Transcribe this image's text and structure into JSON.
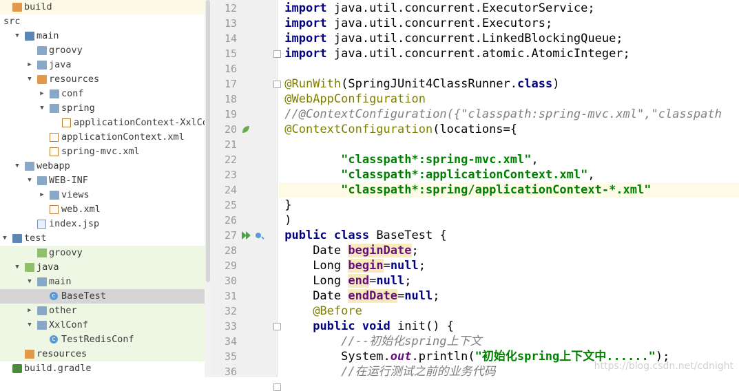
{
  "tree": {
    "items": [
      {
        "label": "build",
        "depth": 0,
        "arrow": "",
        "icon": "folder-orange",
        "bg": "#fdfbe7"
      },
      {
        "label": "src",
        "depth": 0,
        "arrow": "",
        "icon": "none",
        "bg": ""
      },
      {
        "label": "main",
        "depth": 1,
        "arrow": "down",
        "icon": "folder-src",
        "bg": ""
      },
      {
        "label": "groovy",
        "depth": 2,
        "arrow": "",
        "icon": "folder",
        "bg": ""
      },
      {
        "label": "java",
        "depth": 2,
        "arrow": "right",
        "icon": "folder",
        "bg": ""
      },
      {
        "label": "resources",
        "depth": 2,
        "arrow": "down",
        "icon": "folder-orange",
        "bg": ""
      },
      {
        "label": "conf",
        "depth": 3,
        "arrow": "right",
        "icon": "folder",
        "bg": ""
      },
      {
        "label": "spring",
        "depth": 3,
        "arrow": "down",
        "icon": "folder",
        "bg": ""
      },
      {
        "label": "applicationContext-XxlConf.xml",
        "depth": 4,
        "arrow": "",
        "icon": "xml",
        "bg": ""
      },
      {
        "label": "applicationContext.xml",
        "depth": 3,
        "arrow": "",
        "icon": "xml",
        "bg": ""
      },
      {
        "label": "spring-mvc.xml",
        "depth": 3,
        "arrow": "",
        "icon": "xml",
        "bg": ""
      },
      {
        "label": "webapp",
        "depth": 1,
        "arrow": "down",
        "icon": "folder",
        "bg": ""
      },
      {
        "label": "WEB-INF",
        "depth": 2,
        "arrow": "down",
        "icon": "folder",
        "bg": ""
      },
      {
        "label": "views",
        "depth": 3,
        "arrow": "right",
        "icon": "folder",
        "bg": ""
      },
      {
        "label": "web.xml",
        "depth": 3,
        "arrow": "",
        "icon": "xml",
        "bg": ""
      },
      {
        "label": "index.jsp",
        "depth": 2,
        "arrow": "",
        "icon": "jsp",
        "bg": ""
      },
      {
        "label": "test",
        "depth": 0,
        "arrow": "down",
        "icon": "folder-src",
        "bg": ""
      },
      {
        "label": "groovy",
        "depth": 2,
        "arrow": "",
        "icon": "folder-green",
        "bg": "#eef6e4"
      },
      {
        "label": "java",
        "depth": 1,
        "arrow": "down",
        "icon": "folder-green",
        "bg": "#eef6e4"
      },
      {
        "label": "main",
        "depth": 2,
        "arrow": "down",
        "icon": "folder",
        "bg": "#eef6e4"
      },
      {
        "label": "BaseTest",
        "depth": 3,
        "arrow": "",
        "icon": "class",
        "bg": "#d5d5d5"
      },
      {
        "label": "other",
        "depth": 2,
        "arrow": "right",
        "icon": "folder",
        "bg": "#eef6e4"
      },
      {
        "label": "XxlConf",
        "depth": 2,
        "arrow": "down",
        "icon": "folder",
        "bg": "#eef6e4"
      },
      {
        "label": "TestRedisConf",
        "depth": 3,
        "arrow": "",
        "icon": "class",
        "bg": "#eef6e4"
      },
      {
        "label": "resources",
        "depth": 1,
        "arrow": "",
        "icon": "folder-orange",
        "bg": "#eef6e4"
      },
      {
        "label": "build.gradle",
        "depth": 0,
        "arrow": "",
        "icon": "gradle",
        "bg": ""
      }
    ]
  },
  "editor": {
    "lines": [
      {
        "n": "12",
        "hl": false,
        "spans": [
          [
            "kw",
            "import"
          ],
          [
            "plain",
            " java.util.concurrent.ExecutorService;"
          ]
        ]
      },
      {
        "n": "13",
        "hl": false,
        "spans": [
          [
            "kw",
            "import"
          ],
          [
            "plain",
            " java.util.concurrent.Executors;"
          ]
        ]
      },
      {
        "n": "14",
        "hl": false,
        "spans": [
          [
            "kw",
            "import"
          ],
          [
            "plain",
            " java.util.concurrent.LinkedBlockingQueue;"
          ]
        ]
      },
      {
        "n": "15",
        "hl": false,
        "spans": [
          [
            "kw",
            "import"
          ],
          [
            "plain",
            " java.util.concurrent.atomic.AtomicInteger;"
          ]
        ]
      },
      {
        "n": "16",
        "hl": false,
        "spans": []
      },
      {
        "n": "17",
        "hl": false,
        "spans": [
          [
            "ann",
            "@RunWith"
          ],
          [
            "plain",
            "(SpringJUnit4ClassRunner."
          ],
          [
            "kw",
            "class"
          ],
          [
            "plain",
            ")"
          ]
        ]
      },
      {
        "n": "18",
        "hl": false,
        "spans": [
          [
            "ann",
            "@WebAppConfiguration"
          ]
        ]
      },
      {
        "n": "19",
        "hl": false,
        "spans": [
          [
            "cmt",
            "//@ContextConfiguration({\"classpath:spring-mvc.xml\",\"classpath"
          ]
        ]
      },
      {
        "n": "20",
        "hl": false,
        "spans": [
          [
            "ann",
            "@ContextConfiguration"
          ],
          [
            "plain",
            "(locations={"
          ]
        ]
      },
      {
        "n": "21",
        "hl": false,
        "spans": []
      },
      {
        "n": "22",
        "hl": false,
        "spans": [
          [
            "plain",
            "        "
          ],
          [
            "str",
            "\"classpath*:spring-mvc.xml\""
          ],
          [
            "plain",
            ","
          ]
        ]
      },
      {
        "n": "23",
        "hl": false,
        "spans": [
          [
            "plain",
            "        "
          ],
          [
            "str",
            "\"classpath*:applicationContext.xml\""
          ],
          [
            "plain",
            ","
          ]
        ]
      },
      {
        "n": "24",
        "hl": true,
        "spans": [
          [
            "plain",
            "        "
          ],
          [
            "str",
            "\"classpath*:spring/applicationContext-*.xml\""
          ]
        ]
      },
      {
        "n": "25",
        "hl": false,
        "spans": [
          [
            "plain",
            "}"
          ]
        ]
      },
      {
        "n": "26",
        "hl": false,
        "spans": [
          [
            "plain",
            ")"
          ]
        ]
      },
      {
        "n": "27",
        "hl": false,
        "spans": [
          [
            "kw",
            "public class"
          ],
          [
            "plain",
            " BaseTest {"
          ]
        ]
      },
      {
        "n": "28",
        "hl": false,
        "spans": [
          [
            "plain",
            "    Date "
          ],
          [
            "fldbg",
            "beginDate"
          ],
          [
            "plain",
            ";"
          ]
        ]
      },
      {
        "n": "29",
        "hl": false,
        "spans": [
          [
            "plain",
            "    Long "
          ],
          [
            "fldbg",
            "begin"
          ],
          [
            "plain",
            "="
          ],
          [
            "kw",
            "null"
          ],
          [
            "plain",
            ";"
          ]
        ]
      },
      {
        "n": "30",
        "hl": false,
        "spans": [
          [
            "plain",
            "    Long "
          ],
          [
            "fldbg",
            "end"
          ],
          [
            "plain",
            "="
          ],
          [
            "kw",
            "null"
          ],
          [
            "plain",
            ";"
          ]
        ]
      },
      {
        "n": "31",
        "hl": false,
        "spans": [
          [
            "plain",
            "    Date "
          ],
          [
            "fldbg",
            "endDate"
          ],
          [
            "plain",
            "="
          ],
          [
            "kw",
            "null"
          ],
          [
            "plain",
            ";"
          ]
        ]
      },
      {
        "n": "32",
        "hl": false,
        "spans": [
          [
            "plain",
            "    "
          ],
          [
            "ann",
            "@Before"
          ]
        ]
      },
      {
        "n": "33",
        "hl": false,
        "spans": [
          [
            "plain",
            "    "
          ],
          [
            "kw",
            "public void"
          ],
          [
            "plain",
            " init() {"
          ]
        ]
      },
      {
        "n": "34",
        "hl": false,
        "spans": [
          [
            "plain",
            "        "
          ],
          [
            "cmt",
            "//--初始化spring上下文"
          ]
        ]
      },
      {
        "n": "35",
        "hl": false,
        "spans": [
          [
            "plain",
            "        System."
          ],
          [
            "stat",
            "out"
          ],
          [
            "plain",
            ".println("
          ],
          [
            "str",
            "\"初始化spring上下文中......\""
          ],
          [
            "plain",
            ");"
          ]
        ]
      },
      {
        "n": "36",
        "hl": false,
        "spans": [
          [
            "plain",
            "        "
          ],
          [
            "cmt",
            "//在运行测试之前的业务代码"
          ]
        ]
      }
    ]
  },
  "watermark": "https://blog.csdn.net/cdnight",
  "gutter_icons": {
    "line20": "spring-bean-icon",
    "line24": "lightbulb-icon",
    "line27": "run-test-icon"
  }
}
